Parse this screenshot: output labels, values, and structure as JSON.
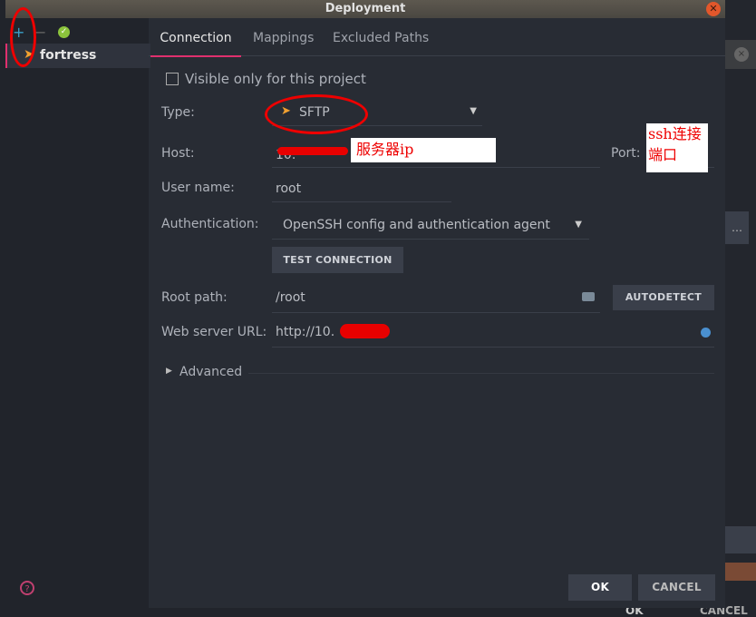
{
  "window": {
    "title": "Deployment"
  },
  "sidebar": {
    "add": "+",
    "remove": "−",
    "servers": [
      {
        "label": "fortress"
      }
    ]
  },
  "tabs": [
    {
      "label": "Connection",
      "active": true
    },
    {
      "label": "Mappings"
    },
    {
      "label": "Excluded Paths"
    }
  ],
  "form": {
    "visible_only": "Visible only for this project",
    "type_label": "Type:",
    "type_value": "SFTP",
    "host_label": "Host:",
    "host_value": "10.",
    "port_label": "Port:",
    "user_label": "User name:",
    "user_value": "root",
    "auth_label": "Authentication:",
    "auth_value": "OpenSSH config and authentication agent",
    "test_button": "TEST CONNECTION",
    "root_label": "Root path:",
    "root_value": "/root",
    "autodetect": "AUTODETECT",
    "web_label": "Web server URL:",
    "web_value": "http://10.",
    "advanced": "Advanced"
  },
  "footer": {
    "ok": "OK",
    "cancel": "CANCEL",
    "help": "?"
  },
  "background": {
    "ok": "OK",
    "cancel": "CANCEL"
  },
  "annotations": {
    "host_note": "服务器ip",
    "port_note": "ssh连接端口"
  },
  "colors": {
    "accent": "#e0306e",
    "annotation": "#e00000"
  }
}
